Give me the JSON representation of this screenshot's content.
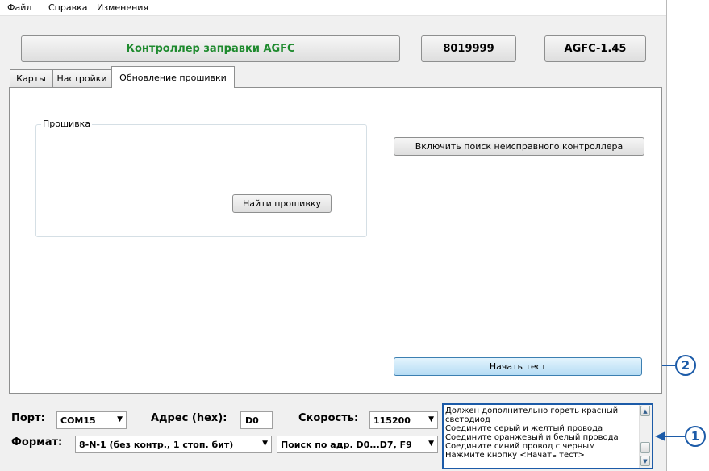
{
  "menu": [
    "Файл",
    "Справка",
    "Изменения"
  ],
  "header": {
    "title": "Контроллер заправки AGFC",
    "serial": "8019999",
    "version": "AGFC-1.45"
  },
  "tabs": [
    "Карты",
    "Настройки",
    "Обновление прошивки"
  ],
  "firmware": {
    "group_title": "Прошивка",
    "find_button": "Найти прошивку"
  },
  "fault_search_button": "Включить поиск неисправного контроллера",
  "start_test_button": "Начать тест",
  "bottom": {
    "port_label": "Порт:",
    "port_value": "COM15",
    "address_label": "Адрес (hex):",
    "address_value": "D0",
    "speed_label": "Скорость:",
    "speed_value": "115200",
    "format_label": "Формат:",
    "format_value": "8-N-1 (без контр., 1 стоп. бит)",
    "search_value": "Поиск по адр. D0...D7, F9"
  },
  "instructions": [
    "Должен дополнительно гореть красный",
    "светодиод",
    "Соедините серый и желтый провода",
    "Соедините оранжевый и белый провода",
    "Соедините синий провод с черным",
    "Нажмите кнопку <Начать тест>"
  ],
  "callouts": [
    "2",
    "1"
  ],
  "colors": {
    "title_green": "#1e8a2e",
    "callout_blue": "#1c5ba8",
    "active_button": "#c8e6f8"
  }
}
